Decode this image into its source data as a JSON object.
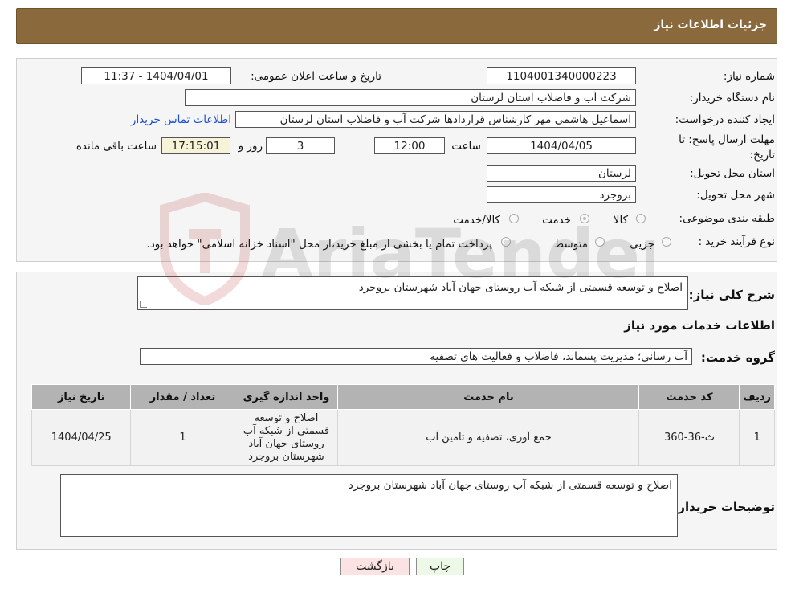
{
  "header": {
    "title": "جزئیات اطلاعات نیاز"
  },
  "form": {
    "need_number_label": "شماره نیاز:",
    "need_number": "1104001340000223",
    "announce_label": "تاریخ و ساعت اعلان عمومی:",
    "announce_value": "1404/04/01 - 11:37",
    "buyer_org_label": "نام دستگاه خریدار:",
    "buyer_org": "شرکت آب و فاضلاب استان لرستان",
    "creator_label": "ایجاد کننده درخواست:",
    "creator": "اسماعیل هاشمی مهر کارشناس قراردادها شرکت آب و فاضلاب استان لرستان",
    "contact_link": "اطلاعات تماس خریدار",
    "deadline_label": "مهلت ارسال پاسخ: تا تاریخ:",
    "deadline_date": "1404/04/05",
    "time_label": "ساعت",
    "deadline_time": "12:00",
    "days_value": "3",
    "days_label": "روز و",
    "remaining_time": "17:15:01",
    "remaining_label": "ساعت باقی مانده",
    "province_label": "استان محل تحویل:",
    "province": "لرستان",
    "city_label": "شهر محل تحویل:",
    "city": "بروجرد",
    "category_label": "طبقه بندی موضوعی:",
    "category_options": [
      "کالا",
      "خدمت",
      "کالا/خدمت"
    ],
    "process_label": "نوع فرآیند خرید :",
    "process_options": [
      "جزیی",
      "متوسط"
    ],
    "process_note": "پرداخت تمام یا بخشی از مبلغ خرید،از محل \"اسناد خزانه اسلامی\" خواهد بود."
  },
  "summary": {
    "label": "شرح کلی نیاز:",
    "text": "اصلاح و توسعه قسمتی از شبکه آب روستای جهان آباد شهرستان بروجرد"
  },
  "services": {
    "section_title": "اطلاعات خدمات مورد نیاز",
    "group_label": "گروه خدمت:",
    "group_value": "آب رسانی؛ مدیریت پسماند، فاضلاب و فعالیت های تصفیه",
    "columns": [
      "ردیف",
      "کد خدمت",
      "نام خدمت",
      "واحد اندازه گیری",
      "تعداد / مقدار",
      "تاریخ نیاز"
    ],
    "rows": [
      [
        "1",
        "ث-36-360",
        "جمع آوری، تصفیه و تامین آب",
        "اصلاح و توسعه قسمتی از شبکه آب روستای جهان آباد شهرستان بروجرد",
        "1",
        "1404/04/25"
      ]
    ]
  },
  "buyer_notes": {
    "label": "توضیحات خریدار:",
    "text": "اصلاح و توسعه قسمتی از شبکه آب روستای جهان آباد شهرستان بروجرد"
  },
  "buttons": {
    "print": "چاپ",
    "back": "بازگشت"
  },
  "watermark": {
    "text": "AriaTender.neT"
  }
}
